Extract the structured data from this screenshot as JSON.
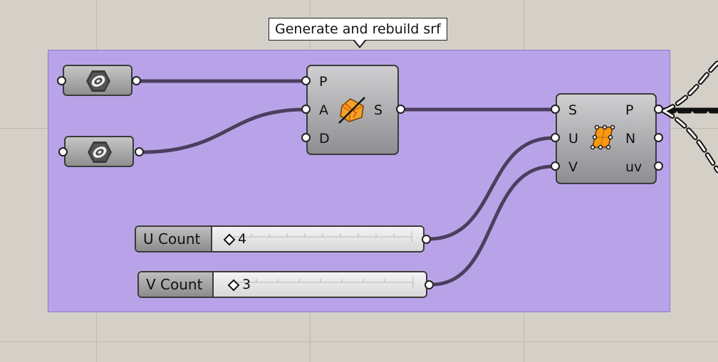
{
  "canvas": {
    "background": "#d4d0c8",
    "group_color": "#b9a3e8"
  },
  "group": {
    "callout_text": "Generate and rebuild srf"
  },
  "params": [
    {
      "icon": "hexagon-nut-icon"
    },
    {
      "icon": "hexagon-nut-icon"
    }
  ],
  "rebuild_component": {
    "icon": "rebuild-surface-icon",
    "inputs": [
      "P",
      "A",
      "D"
    ],
    "outputs": [
      "S"
    ]
  },
  "eval_component": {
    "icon": "evaluate-surface-icon",
    "inputs": [
      "S",
      "U",
      "V"
    ],
    "outputs": [
      "P",
      "N",
      "uv"
    ]
  },
  "sliders": [
    {
      "label": "U Count",
      "value": "4"
    },
    {
      "label": "V Count",
      "value": "3"
    }
  ]
}
